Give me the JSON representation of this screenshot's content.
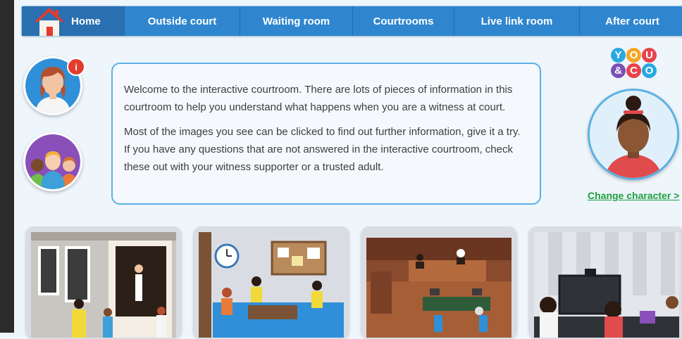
{
  "nav": {
    "items": [
      {
        "label": "Home"
      },
      {
        "label": "Outside court"
      },
      {
        "label": "Waiting room"
      },
      {
        "label": "Courtrooms"
      },
      {
        "label": "Live link room"
      },
      {
        "label": "After court"
      }
    ]
  },
  "welcome": {
    "paragraph1": "Welcome to the interactive courtroom. There are lots of pieces of information in this courtroom to help you understand what happens when you are a witness at court.",
    "paragraph2": "Most of the images you see can be clicked to find out further information, give it a try. If you have any questions that are not answered in the interactive courtroom, check these out with your witness supporter or a trusted adult."
  },
  "badge": {
    "text": "i"
  },
  "logo": {
    "letters": [
      "Y",
      "O",
      "U",
      "&",
      "C",
      "O"
    ]
  },
  "character": {
    "change_link": "Change character >"
  },
  "colors": {
    "nav_blue": "#2f86cf",
    "nav_home": "#2a6fb0",
    "accent_border": "#5bb0e4",
    "link_green": "#1e9e3c",
    "badge_red": "#e23c2c",
    "logo_colors": [
      "#29a8e0",
      "#f5a623",
      "#e8434a",
      "#7b4fb3",
      "#e8434a",
      "#29a8e0"
    ]
  },
  "cards": [
    {
      "name": "outside-court"
    },
    {
      "name": "waiting-room"
    },
    {
      "name": "courtrooms"
    },
    {
      "name": "live-link-room"
    }
  ]
}
